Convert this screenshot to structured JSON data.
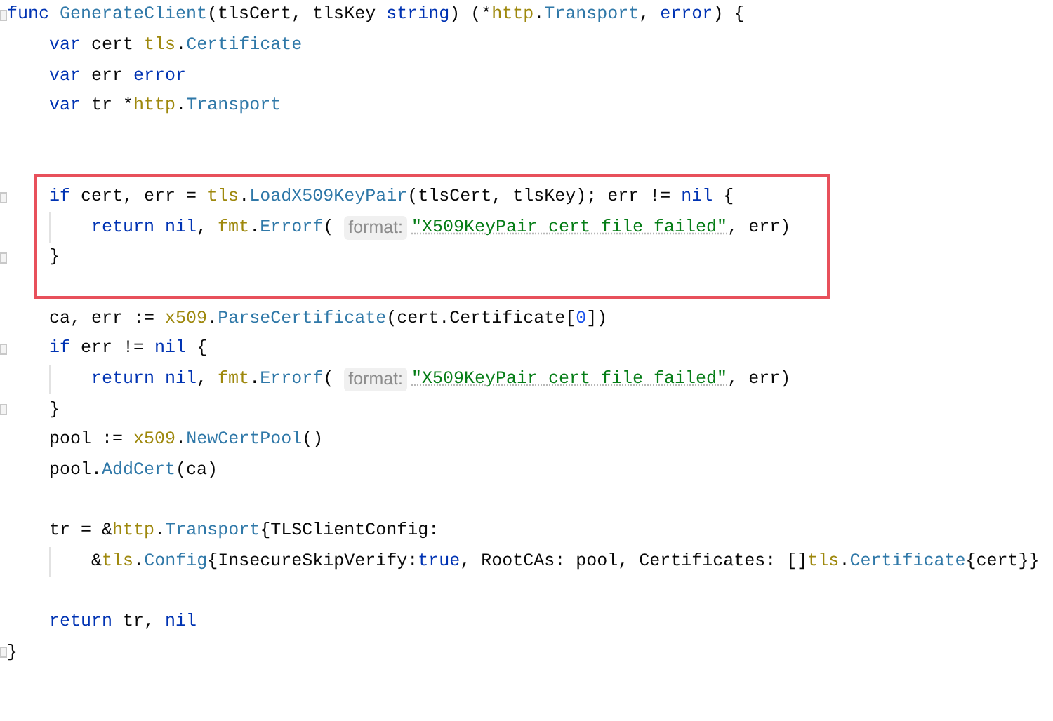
{
  "editor": {
    "lines": [
      {
        "fold": true,
        "boxed": false,
        "tokens": [
          {
            "kind": "kw",
            "text": "func "
          },
          {
            "kind": "member",
            "text": "GenerateClient"
          },
          {
            "kind": "plain",
            "text": "(tlsCert, tlsKey "
          },
          {
            "kind": "kw",
            "text": "string"
          },
          {
            "kind": "plain",
            "text": ") (*"
          },
          {
            "kind": "pkg",
            "text": "http"
          },
          {
            "kind": "plain",
            "text": "."
          },
          {
            "kind": "member",
            "text": "Transport"
          },
          {
            "kind": "plain",
            "text": ", "
          },
          {
            "kind": "kw",
            "text": "error"
          },
          {
            "kind": "plain",
            "text": ") {"
          }
        ]
      },
      {
        "fold": false,
        "boxed": false,
        "tokens": [
          {
            "kind": "kw",
            "text": "    var "
          },
          {
            "kind": "plain",
            "text": "cert "
          },
          {
            "kind": "pkg",
            "text": "tls"
          },
          {
            "kind": "plain",
            "text": "."
          },
          {
            "kind": "member",
            "text": "Certificate"
          }
        ]
      },
      {
        "fold": false,
        "boxed": false,
        "tokens": [
          {
            "kind": "kw",
            "text": "    var "
          },
          {
            "kind": "plain",
            "text": "err "
          },
          {
            "kind": "kw",
            "text": "error"
          }
        ]
      },
      {
        "fold": false,
        "boxed": false,
        "tokens": [
          {
            "kind": "kw",
            "text": "    var "
          },
          {
            "kind": "plain",
            "text": "tr *"
          },
          {
            "kind": "pkg",
            "text": "http"
          },
          {
            "kind": "plain",
            "text": "."
          },
          {
            "kind": "member",
            "text": "Transport"
          }
        ]
      },
      {
        "fold": false,
        "boxed": false
      },
      {
        "fold": false,
        "boxed": false
      },
      {
        "fold": true,
        "boxed": true,
        "tokens": [
          {
            "kind": "kw",
            "text": "    if "
          },
          {
            "kind": "plain",
            "text": "cert, err = "
          },
          {
            "kind": "pkg",
            "text": "tls"
          },
          {
            "kind": "plain",
            "text": "."
          },
          {
            "kind": "member",
            "text": "LoadX509KeyPair"
          },
          {
            "kind": "plain",
            "text": "(tlsCert, tlsKey); err != "
          },
          {
            "kind": "kw",
            "text": "nil"
          },
          {
            "kind": "plain",
            "text": " {"
          }
        ]
      },
      {
        "fold": false,
        "boxed": true,
        "tokens": [
          {
            "kind": "kw",
            "text": "        return nil"
          },
          {
            "kind": "plain",
            "text": ", "
          },
          {
            "kind": "pkg",
            "text": "fmt"
          },
          {
            "kind": "plain",
            "text": "."
          },
          {
            "kind": "member",
            "text": "Errorf"
          },
          {
            "kind": "plain",
            "text": "( "
          },
          {
            "kind": "hint",
            "text": "format:"
          },
          {
            "kind": "str",
            "text": "\"X509KeyPair cert file failed\""
          },
          {
            "kind": "plain",
            "text": ", err)"
          }
        ]
      },
      {
        "fold": true,
        "boxed": true,
        "tokens": [
          {
            "kind": "plain",
            "text": "    }"
          }
        ]
      },
      {
        "fold": false,
        "boxed": true
      },
      {
        "fold": false,
        "boxed": false,
        "tokens": [
          {
            "kind": "plain",
            "text": "    ca, err := "
          },
          {
            "kind": "pkg",
            "text": "x509"
          },
          {
            "kind": "plain",
            "text": "."
          },
          {
            "kind": "member",
            "text": "ParseCertificate"
          },
          {
            "kind": "plain",
            "text": "(cert.Certificate["
          },
          {
            "kind": "num",
            "text": "0"
          },
          {
            "kind": "plain",
            "text": "])"
          }
        ]
      },
      {
        "fold": true,
        "boxed": false,
        "tokens": [
          {
            "kind": "kw",
            "text": "    if "
          },
          {
            "kind": "plain",
            "text": "err != "
          },
          {
            "kind": "kw",
            "text": "nil"
          },
          {
            "kind": "plain",
            "text": " {"
          }
        ]
      },
      {
        "fold": false,
        "boxed": false,
        "tokens": [
          {
            "kind": "kw",
            "text": "        return nil"
          },
          {
            "kind": "plain",
            "text": ", "
          },
          {
            "kind": "pkg",
            "text": "fmt"
          },
          {
            "kind": "plain",
            "text": "."
          },
          {
            "kind": "member",
            "text": "Errorf"
          },
          {
            "kind": "plain",
            "text": "( "
          },
          {
            "kind": "hint",
            "text": "format:"
          },
          {
            "kind": "str",
            "text": "\"X509KeyPair cert file failed\""
          },
          {
            "kind": "plain",
            "text": ", err)"
          }
        ]
      },
      {
        "fold": true,
        "boxed": false,
        "tokens": [
          {
            "kind": "plain",
            "text": "    }"
          }
        ]
      },
      {
        "fold": false,
        "boxed": false,
        "tokens": [
          {
            "kind": "plain",
            "text": "    pool := "
          },
          {
            "kind": "pkg",
            "text": "x509"
          },
          {
            "kind": "plain",
            "text": "."
          },
          {
            "kind": "member",
            "text": "NewCertPool"
          },
          {
            "kind": "plain",
            "text": "()"
          }
        ]
      },
      {
        "fold": false,
        "boxed": false,
        "tokens": [
          {
            "kind": "plain",
            "text": "    pool."
          },
          {
            "kind": "member",
            "text": "AddCert"
          },
          {
            "kind": "plain",
            "text": "(ca)"
          }
        ]
      },
      {
        "fold": false,
        "boxed": false
      },
      {
        "fold": false,
        "boxed": false,
        "tokens": [
          {
            "kind": "plain",
            "text": "    tr = &"
          },
          {
            "kind": "pkg",
            "text": "http"
          },
          {
            "kind": "plain",
            "text": "."
          },
          {
            "kind": "member",
            "text": "Transport"
          },
          {
            "kind": "plain",
            "text": "{TLSClientConfig:"
          }
        ]
      },
      {
        "fold": false,
        "boxed": false,
        "tokens": [
          {
            "kind": "plain",
            "text": "        &"
          },
          {
            "kind": "pkg",
            "text": "tls"
          },
          {
            "kind": "plain",
            "text": "."
          },
          {
            "kind": "member",
            "text": "Config"
          },
          {
            "kind": "plain",
            "text": "{InsecureSkipVerify:"
          },
          {
            "kind": "kw",
            "text": "true"
          },
          {
            "kind": "plain",
            "text": ", RootCAs: pool, Certificates: []"
          },
          {
            "kind": "pkg",
            "text": "tls"
          },
          {
            "kind": "plain",
            "text": "."
          },
          {
            "kind": "member",
            "text": "Certificate"
          },
          {
            "kind": "plain",
            "text": "{cert}}"
          }
        ]
      },
      {
        "fold": false,
        "boxed": false
      },
      {
        "fold": false,
        "boxed": false,
        "tokens": [
          {
            "kind": "kw",
            "text": "    return "
          },
          {
            "kind": "plain",
            "text": "tr, "
          },
          {
            "kind": "kw",
            "text": "nil"
          }
        ]
      },
      {
        "fold": true,
        "boxed": false,
        "tokens": [
          {
            "kind": "plain",
            "text": "}"
          }
        ]
      }
    ]
  }
}
